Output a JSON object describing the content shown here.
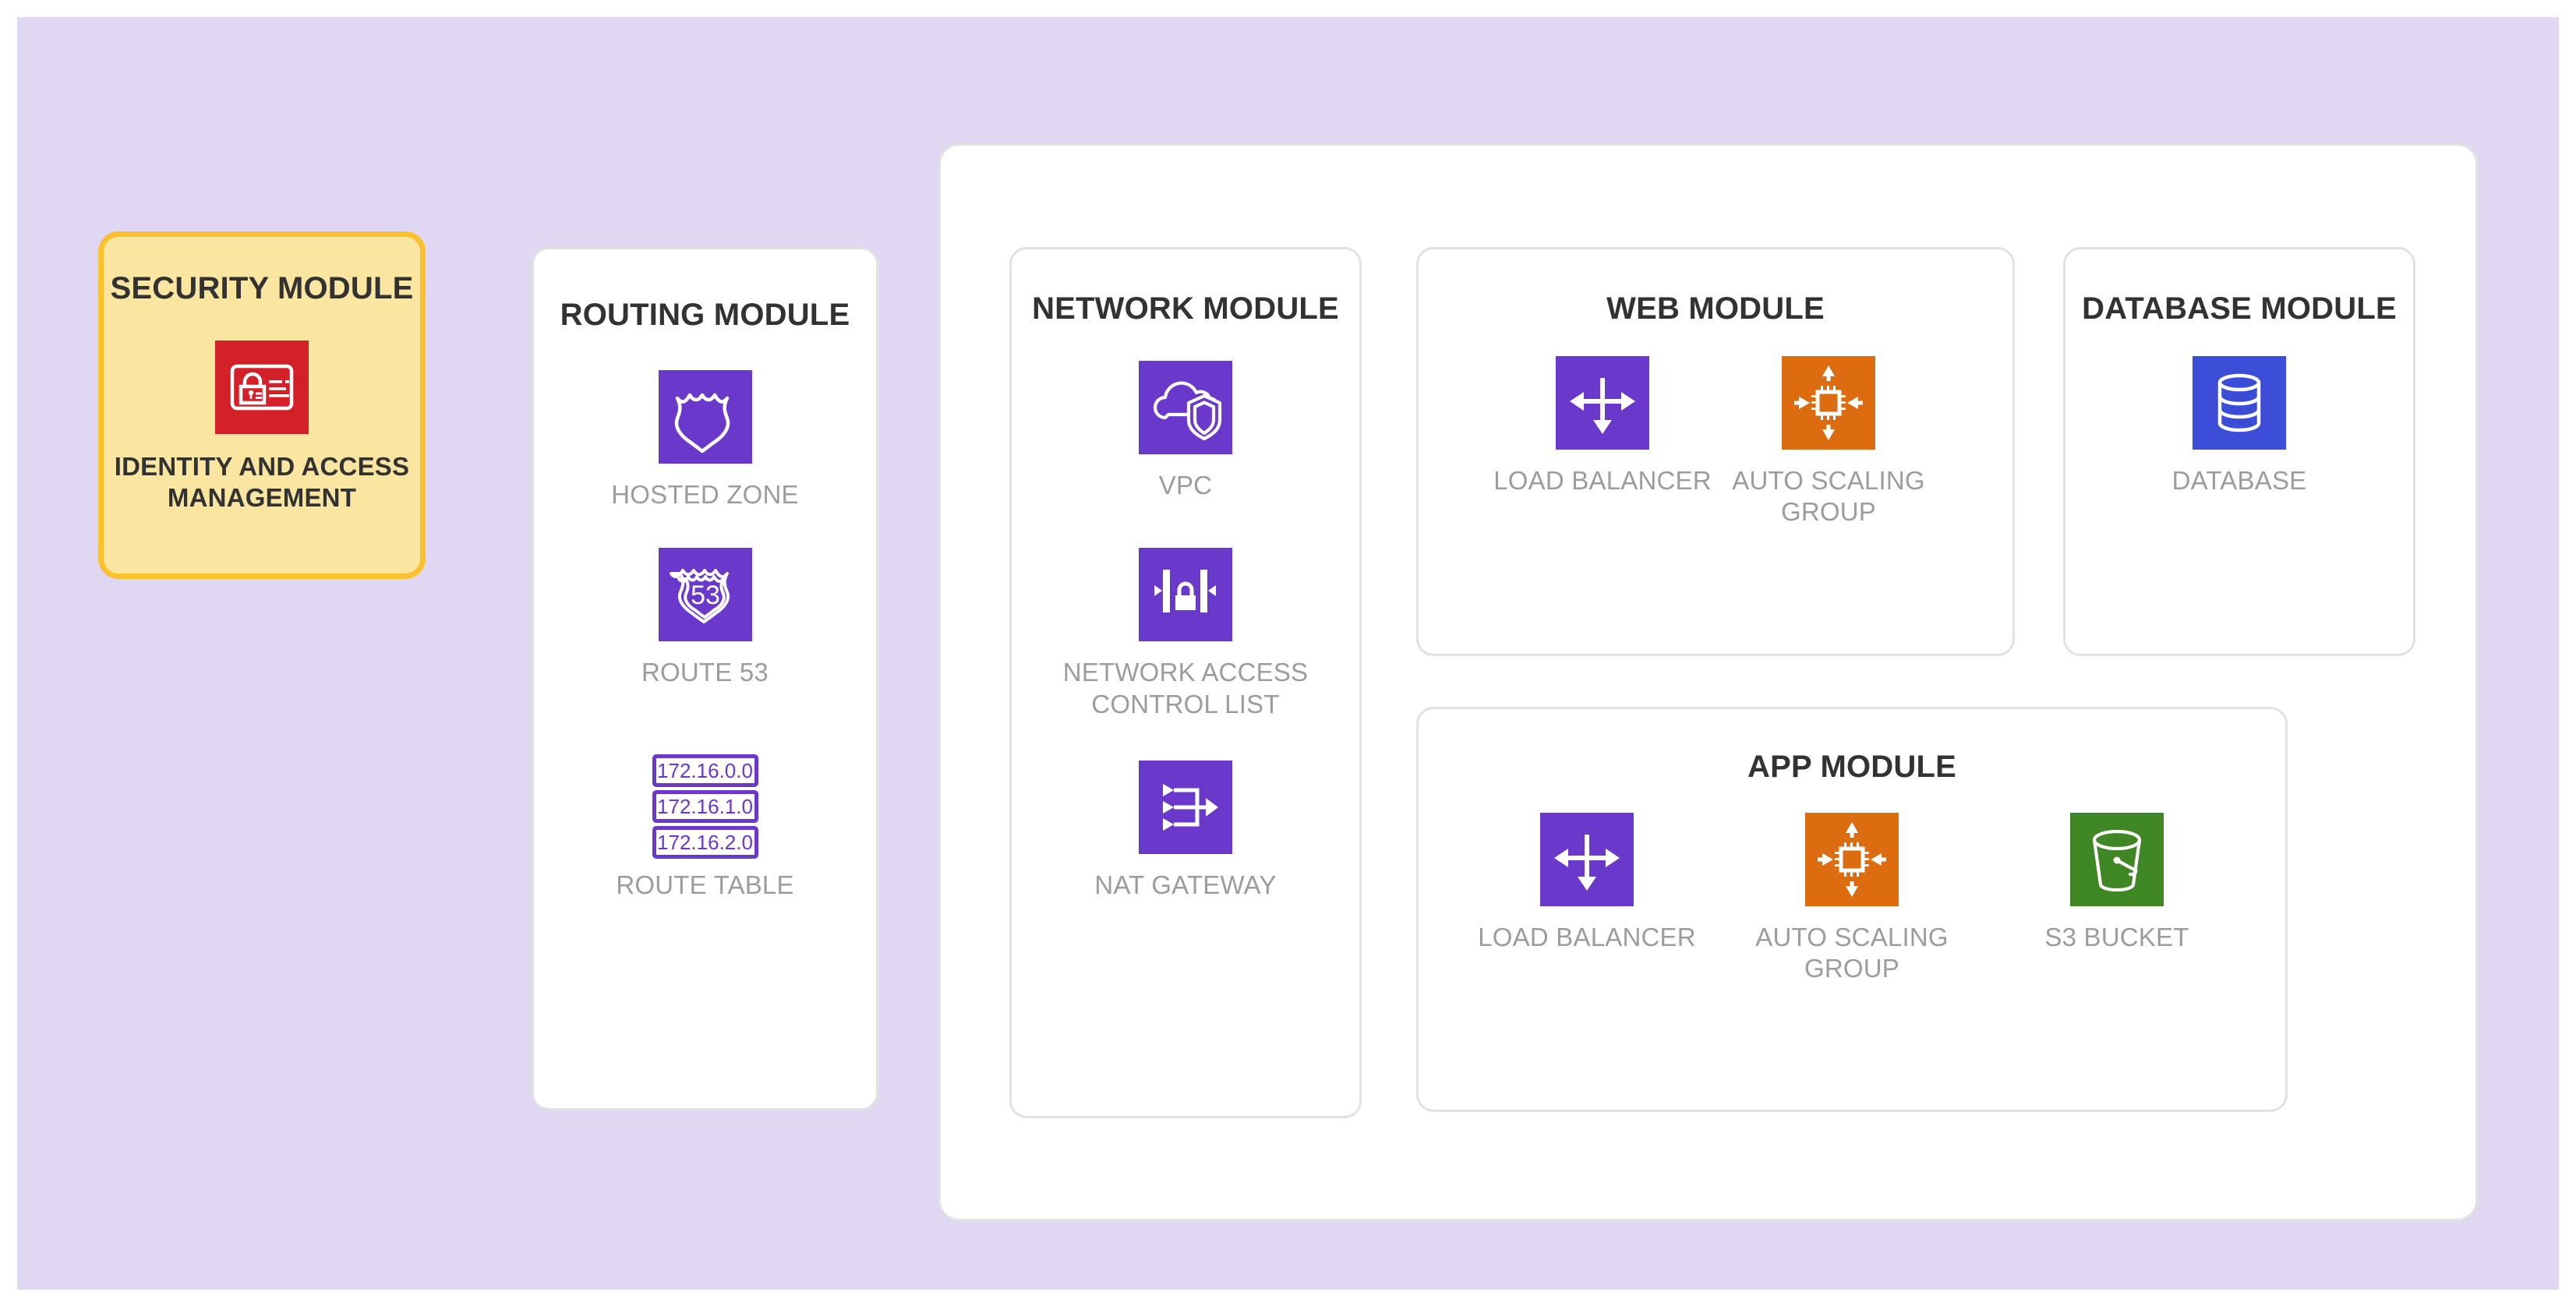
{
  "canvas": {
    "background_color": "#E0D7F2"
  },
  "security_module": {
    "title": "SECURITY MODULE",
    "background_color": "#FAE6A0",
    "border_color": "#FBC02D",
    "items": [
      {
        "label": "IDENTITY AND ACCESS MANAGEMENT",
        "icon": "iam-icon",
        "icon_color": "#D32029"
      }
    ]
  },
  "routing_module": {
    "title": "ROUTING MODULE",
    "items": [
      {
        "label": "HOSTED ZONE",
        "icon": "hosted-zone-shield-icon",
        "icon_color": "#6B38CC"
      },
      {
        "label": "ROUTE 53",
        "icon": "route-53-shield-icon",
        "icon_color": "#6B38CC",
        "icon_text": "53"
      },
      {
        "label": "ROUTE TABLE",
        "icon": "route-table-icon",
        "icon_color": "#6B38CC",
        "cidr_blocks": [
          "172.16.0.0",
          "172.16.1.0",
          "172.16.2.0"
        ]
      }
    ]
  },
  "network_module": {
    "title": "NETWORK MODULE",
    "items": [
      {
        "label": "VPC",
        "icon": "vpc-cloud-shield-icon",
        "icon_color": "#6B38CC"
      },
      {
        "label": "NETWORK ACCESS CONTROL LIST",
        "icon": "nacl-lock-icon",
        "icon_color": "#6B38CC"
      },
      {
        "label": "NAT GATEWAY",
        "icon": "nat-gateway-icon",
        "icon_color": "#6B38CC"
      }
    ]
  },
  "web_module": {
    "title": "WEB MODULE",
    "items": [
      {
        "label": "LOAD BALANCER",
        "icon": "load-balancer-icon",
        "icon_color": "#6B38CC"
      },
      {
        "label": "AUTO SCALING GROUP",
        "icon": "auto-scaling-group-icon",
        "icon_color": "#DD6B10"
      }
    ]
  },
  "database_module": {
    "title": "DATABASE MODULE",
    "items": [
      {
        "label": "DATABASE",
        "icon": "database-cylinder-icon",
        "icon_color": "#3B4CD6"
      }
    ]
  },
  "app_module": {
    "title": "APP MODULE",
    "items": [
      {
        "label": "LOAD BALANCER",
        "icon": "load-balancer-icon",
        "icon_color": "#6B38CC"
      },
      {
        "label": "AUTO SCALING GROUP",
        "icon": "auto-scaling-group-icon",
        "icon_color": "#DD6B10"
      },
      {
        "label": "S3 BUCKET",
        "icon": "s3-bucket-icon",
        "icon_color": "#3F8624"
      }
    ]
  }
}
